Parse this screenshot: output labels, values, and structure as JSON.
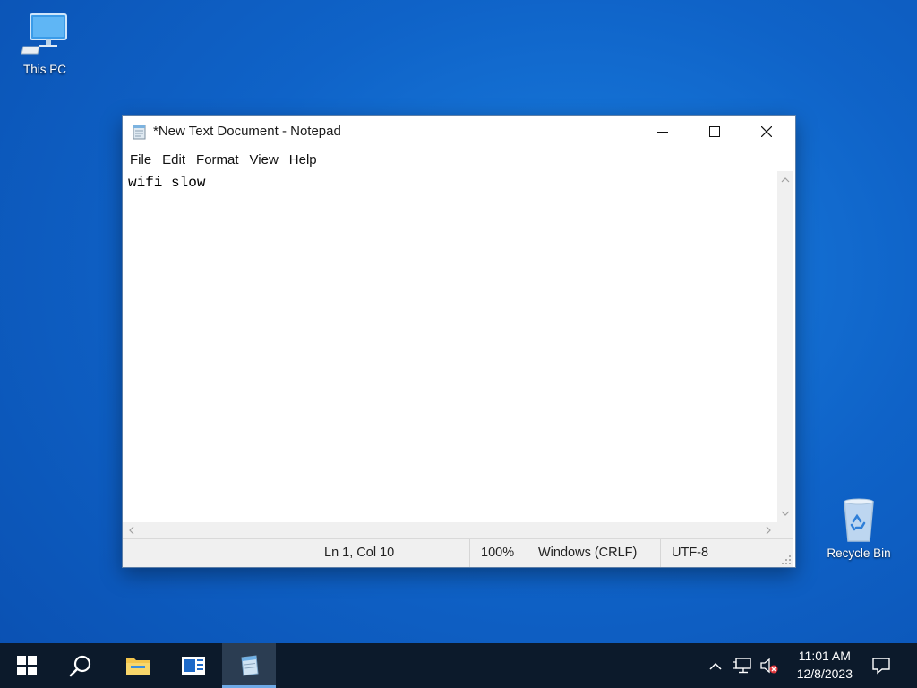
{
  "desktop": {
    "icons": [
      {
        "label": "This PC",
        "icon": "computer-icon"
      },
      {
        "label": "Recycle Bin",
        "icon": "recycle-bin-icon"
      }
    ]
  },
  "notepad": {
    "title": "*New Text Document - Notepad",
    "menu": [
      "File",
      "Edit",
      "Format",
      "View",
      "Help"
    ],
    "content": "wifi slow",
    "status": {
      "position": "Ln 1, Col 10",
      "zoom": "100%",
      "line_ending": "Windows (CRLF)",
      "encoding": "UTF-8"
    }
  },
  "taskbar": {
    "items": [
      "start-icon",
      "search-icon",
      "file-explorer-icon",
      "news-icon",
      "notepad-icon"
    ],
    "active": "notepad-icon",
    "tray_icons": [
      "chevron-up-icon",
      "network-icon",
      "volume-muted-icon",
      "notification-icon"
    ],
    "time": "11:01 AM",
    "date": "12/8/2023"
  },
  "colors": {
    "accent": "#0f63c8",
    "taskbar": "#0c1a2b",
    "active_indicator": "#6ea9e6"
  }
}
